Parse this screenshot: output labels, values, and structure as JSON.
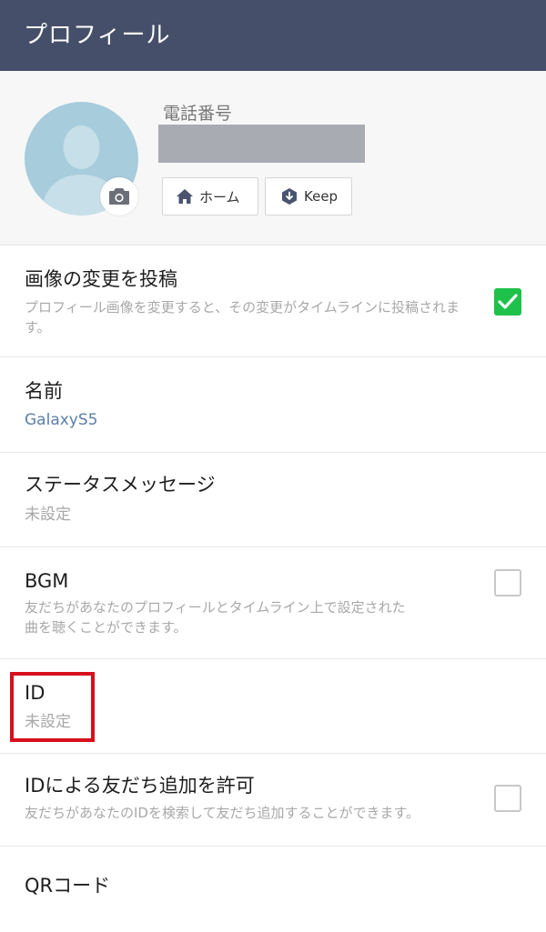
{
  "app_bar": {
    "title": "プロフィール"
  },
  "profile": {
    "phone_label": "電話番号",
    "home_button": "ホーム",
    "keep_button": "Keep"
  },
  "settings": {
    "post_image_change": {
      "title": "画像の変更を投稿",
      "description": "プロフィール画像を変更すると、その変更がタイムラインに投稿されます。",
      "checked": true
    },
    "name": {
      "title": "名前",
      "value": "GalaxyS5"
    },
    "status_message": {
      "title": "ステータスメッセージ",
      "value": "未設定"
    },
    "bgm": {
      "title": "BGM",
      "description": "友だちがあなたのプロフィールとタイムライン上で設定された曲を聴くことができます。",
      "checked": false
    },
    "id": {
      "title": "ID",
      "value": "未設定"
    },
    "allow_add_by_id": {
      "title": "IDによる友だち追加を許可",
      "description": "友だちがあなたのIDを検索して友だち追加することができます。",
      "checked": false
    },
    "qr_code": {
      "title": "QRコード"
    }
  },
  "colors": {
    "app_bar_bg": "#464f69",
    "checkbox_checked": "#1ec24a",
    "name_value": "#5b7fa8",
    "highlight": "#d7101d"
  },
  "icons": {
    "avatar": "default-avatar-icon",
    "camera": "camera-icon",
    "home": "home-icon",
    "keep": "keep-icon",
    "check": "checkmark-icon"
  }
}
